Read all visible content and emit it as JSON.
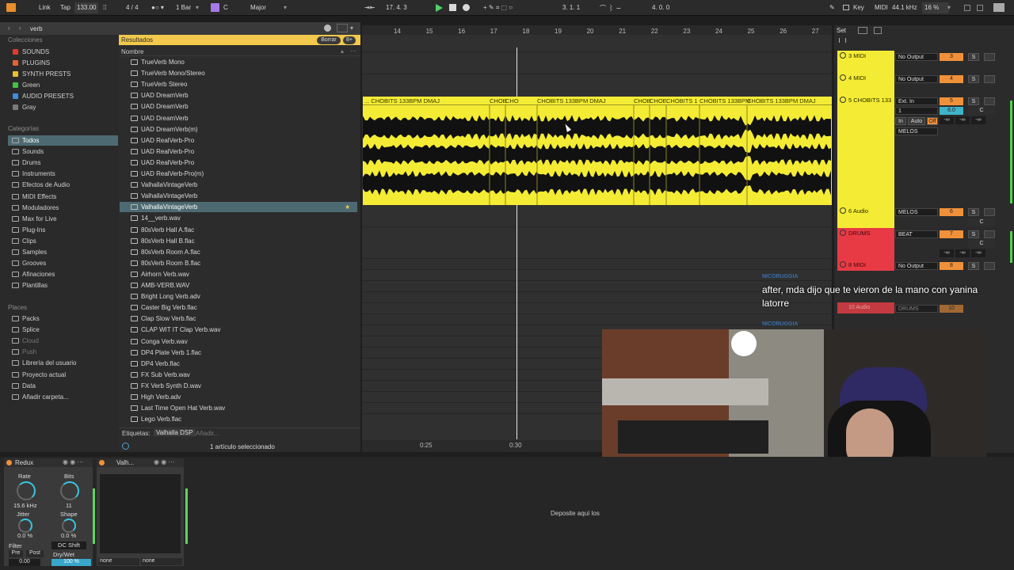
{
  "transport": {
    "link": "Link",
    "tap": "Tap",
    "tempo": "133.00",
    "signature": "4 / 4",
    "quantize": "1 Bar",
    "key_root": "C",
    "scale": "Major",
    "position": "17.  4.  3",
    "loop_start": "3.  1.  1",
    "loop_length": "4.  0.  0",
    "key_label": "Key",
    "midi_label": "MIDI",
    "sample_rate": "44.1 kHz",
    "cpu": "16 %"
  },
  "browser": {
    "search_value": "verb",
    "collections_title": "Colecciones",
    "collections": [
      {
        "label": "SOUNDS",
        "color": "#e0392f"
      },
      {
        "label": "PLUGINS",
        "color": "#e5622f"
      },
      {
        "label": "SYNTH PRESTS",
        "color": "#e8c12f"
      },
      {
        "label": "Green",
        "color": "#43c24a"
      },
      {
        "label": "AUDIO PRESETS",
        "color": "#3d8ee0"
      },
      {
        "label": "Gray",
        "color": "#7a7a7a"
      }
    ],
    "categories_title": "Categorías",
    "categories": [
      "Todos",
      "Sounds",
      "Drums",
      "Instruments",
      "Efectos de Audio",
      "MIDI Effects",
      "Moduladores",
      "Max for Live",
      "Plug-Ins",
      "Clips",
      "Samples",
      "Grooves",
      "Afinaciones",
      "Plantillas"
    ],
    "places_title": "Places",
    "places": [
      "Packs",
      "Splice",
      "Cloud",
      "Push",
      "Librería del usuario",
      "Proyecto actual",
      "Data",
      "Añadir carpeta..."
    ],
    "results_title": "Resultados",
    "clear_label": "Borrar",
    "column_name": "Nombre",
    "results": [
      "TrueVerb Mono",
      "TrueVerb Mono/Stereo",
      "TrueVerb Stereo",
      "UAD DreamVerb",
      "UAD DreamVerb",
      "UAD DreamVerb",
      "UAD DreamVerb(m)",
      "UAD RealVerb-Pro",
      "UAD RealVerb-Pro",
      "UAD RealVerb-Pro",
      "UAD RealVerb-Pro(m)",
      "ValhallaVintageVerb",
      "ValhallaVintageVerb",
      "ValhallaVintageVerb",
      "14__verb.wav",
      "80sVerb Hall A.flac",
      "80sVerb Hall B.flac",
      "80sVerb Room A.flac",
      "80sVerb Room B.flac",
      "Airhorn Verb.wav",
      "AMB-VERB.WAV",
      "Bright Long Verb.adv",
      "Caster Big Verb.flac",
      "Clap Slow Verb.flac",
      "CLAP WIT IT Clap Verb.wav",
      "Conga Verb.wav",
      "DP4 Plate Verb 1.flac",
      "DP4 Verb.flac",
      "FX Sub Verb.wav",
      "FX Verb Synth D.wav",
      "High Verb.adv",
      "Last Time Open Hat Verb.wav",
      "Lego Verb.flac"
    ],
    "tags_label": "Etiquetas:",
    "tag_value": "Valhalla DSP",
    "tag_add": "Añadir...",
    "status": "1 artículo seleccionado"
  },
  "arrangement": {
    "ruler": [
      "14",
      "15",
      "16",
      "17",
      "18",
      "19",
      "20",
      "21",
      "22",
      "23",
      "24",
      "25",
      "26",
      "27"
    ],
    "clip_segments": [
      "... CHOBITS 133BPM DMAJ",
      "CHOB",
      "CHO",
      "CHOBITS 133BPM DMAJ",
      "CHOB",
      "CHOE",
      "CHOBITS 1",
      "CHOBITS 133BPM",
      "CHOBITS 133BPM DMAJ"
    ],
    "time_marks": [
      "0:25",
      "0:30"
    ],
    "drop_hint": "Deposite aquí los"
  },
  "mixer": {
    "set_label": "Set",
    "tracks": [
      {
        "name": "3 MIDI",
        "color": "#f4ec34",
        "output": "No Output",
        "num": "3"
      },
      {
        "name": "4 MIDI",
        "color": "#f4ec34",
        "output": "No Output",
        "num": "4"
      },
      {
        "name": "5 CHOBITS 133",
        "color": "#f4ec34",
        "output": "Ext. In",
        "num": "5",
        "extra": [
          "1",
          "MELOS"
        ],
        "volume": "6.0",
        "monitor": [
          "In",
          "Auto",
          "Off"
        ]
      },
      {
        "name": "6 Audio",
        "color": "#f4ec34",
        "output": "MELOS",
        "num": "6"
      },
      {
        "name": "DRUMS",
        "color": "#e83a45",
        "output": "BEAT",
        "num": "7"
      },
      {
        "name": "8 MIDI",
        "color": "#e83a45",
        "output": "No Output",
        "num": "8"
      }
    ],
    "pan_center": "C",
    "send_inf": "-∞",
    "faded": {
      "track": "10 Audio",
      "output": "DRUMS",
      "num": "10"
    }
  },
  "chat": {
    "user": "NICORUGGIA",
    "message": "after, mda dijo que te vieron de la mano con yanina latorre",
    "user2": "NICORUGGIA"
  },
  "devices": {
    "redux": {
      "title": "Redux",
      "rate_label": "Rate",
      "rate_value": "15.6 kHz",
      "bits_label": "Bits",
      "bits_value": "11",
      "jitter_label": "Jitter",
      "jitter_value": "0.0 %",
      "shape_label": "Shape",
      "shape_value": "0.0 %",
      "filter_label": "Filter",
      "dc_label": "DC Shift",
      "pre": "Pre",
      "post": "Post",
      "drywet_label": "Dry/Wet",
      "filter_value": "0.00",
      "drywet_value": "100 %"
    },
    "valhalla": {
      "title": "Valh...",
      "opt1": "none",
      "opt2": "none"
    }
  }
}
